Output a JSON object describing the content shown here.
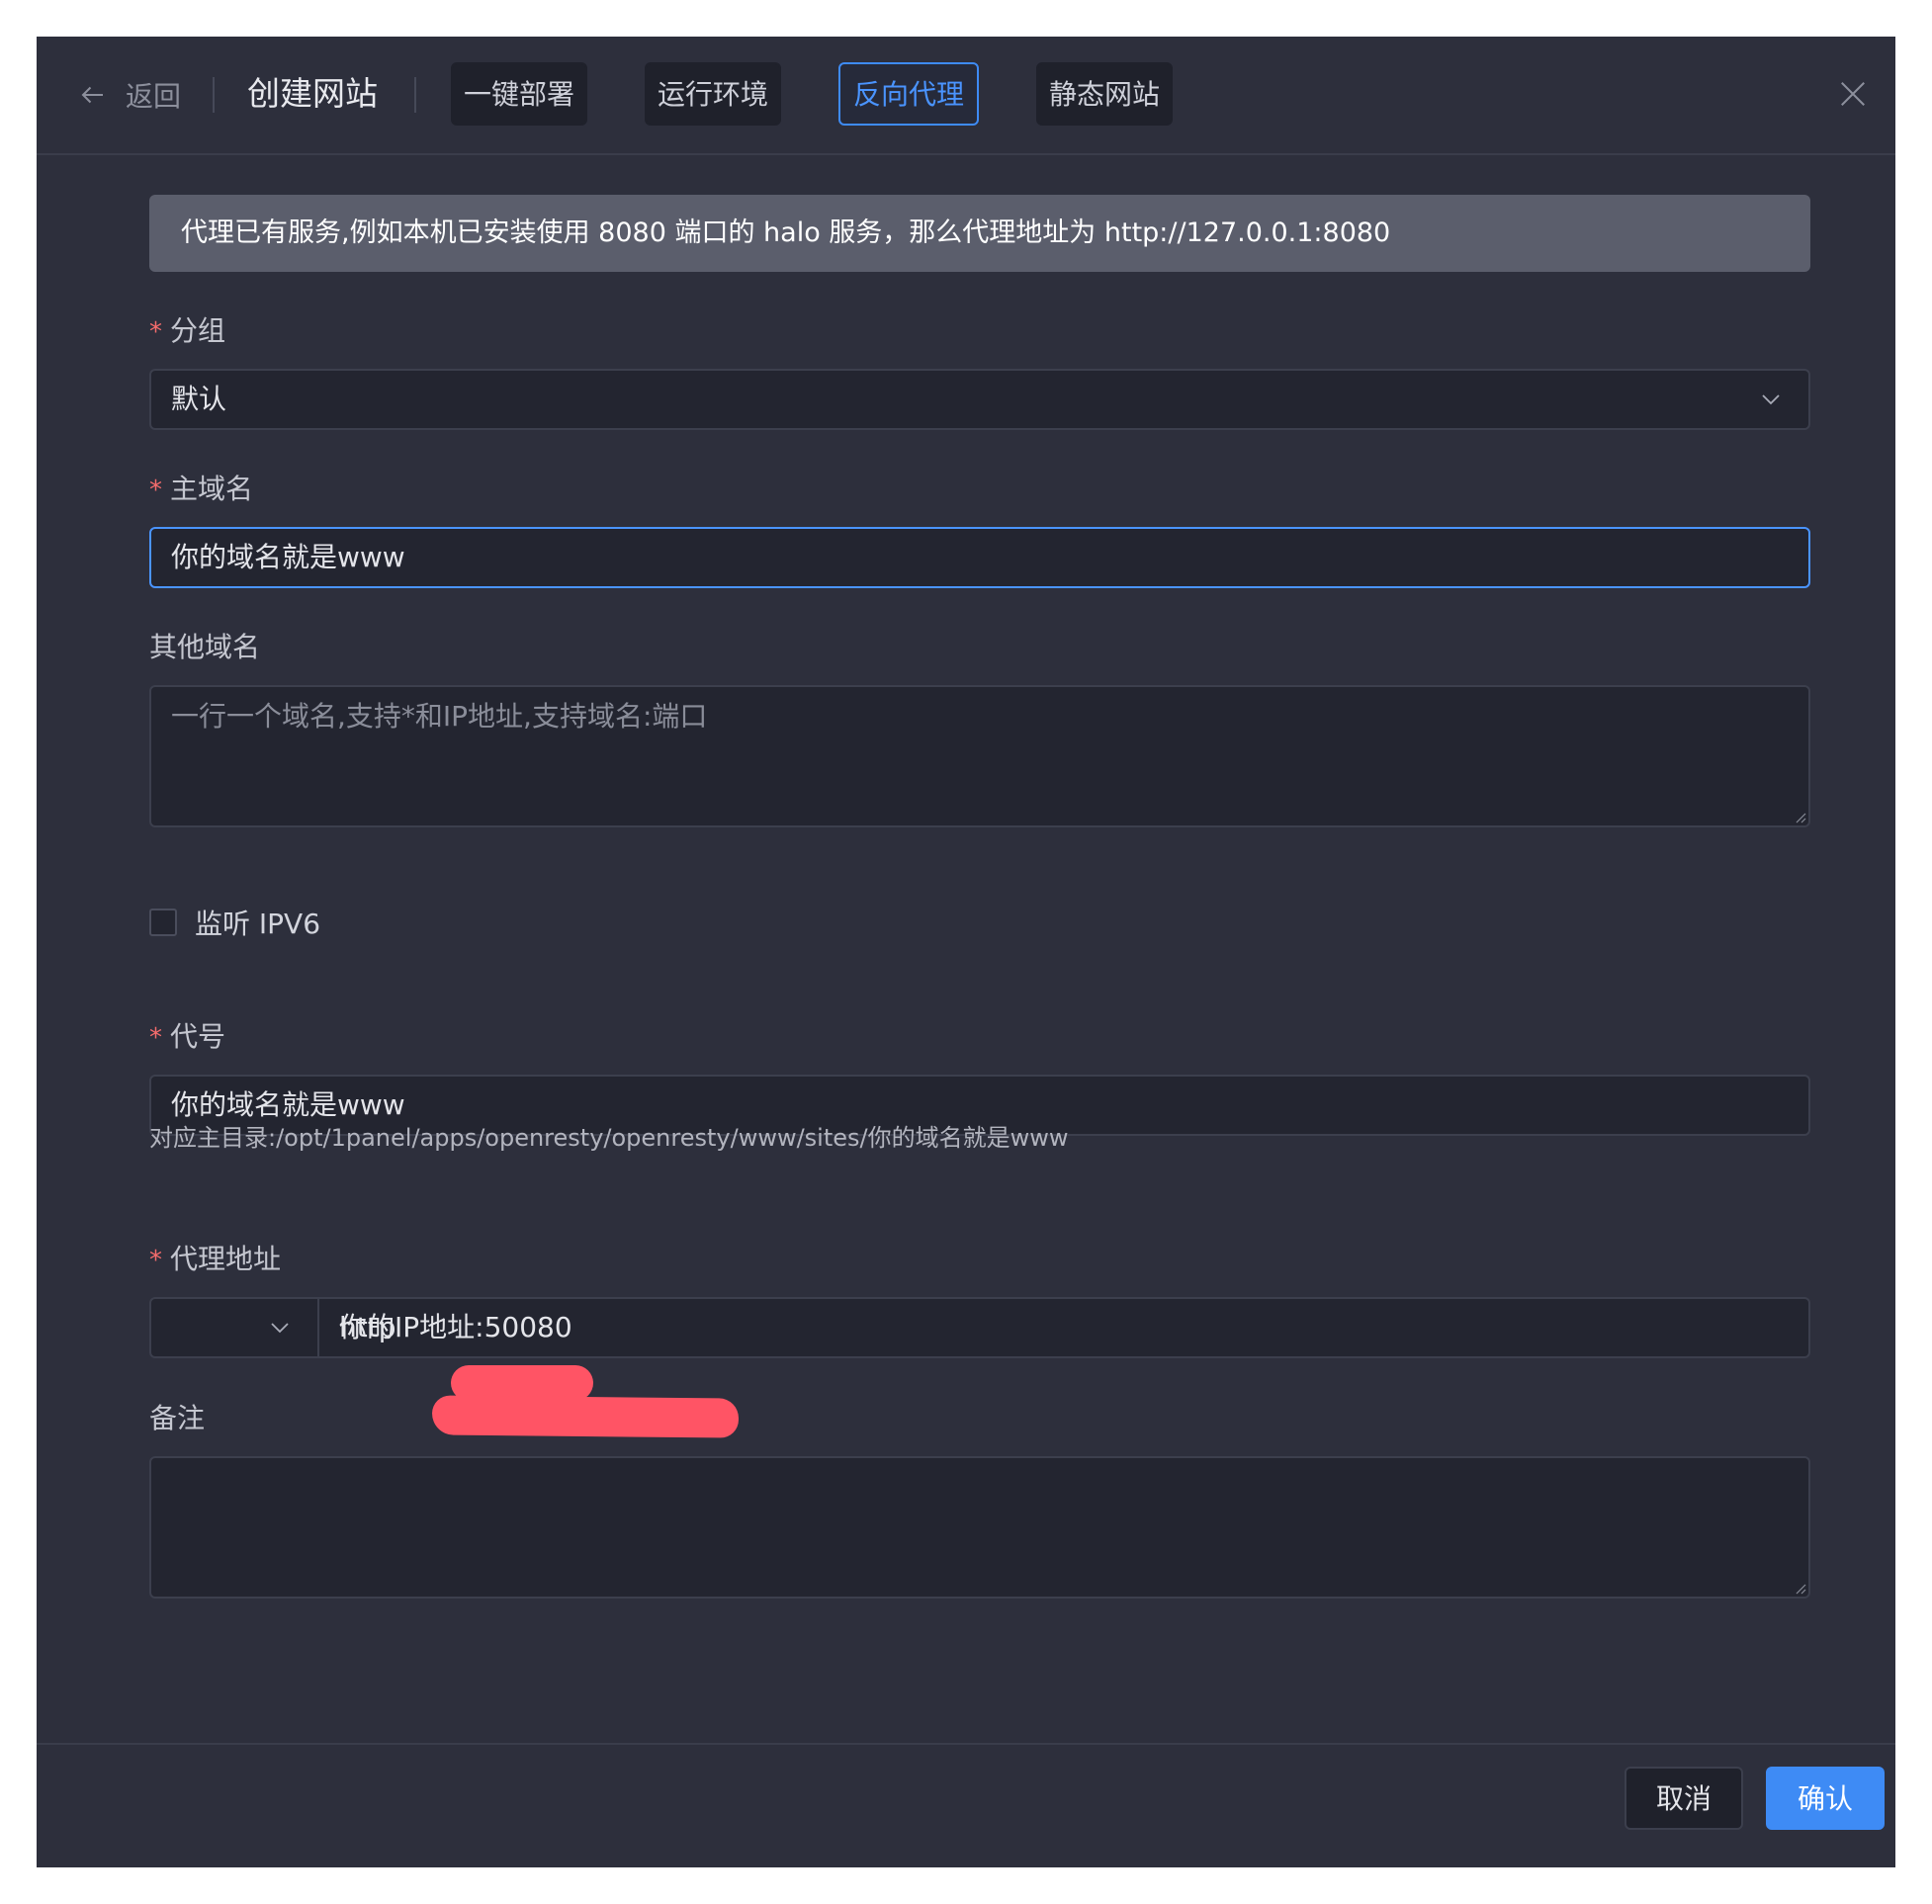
{
  "header": {
    "back_label": "返回",
    "title": "创建网站",
    "tabs": [
      {
        "label": "一键部署",
        "active": false
      },
      {
        "label": "运行环境",
        "active": false
      },
      {
        "label": "反向代理",
        "active": true
      },
      {
        "label": "静态网站",
        "active": false
      }
    ]
  },
  "alert": {
    "text": "代理已有服务,例如本机已安装使用 8080 端口的 halo 服务，那么代理地址为 http://127.0.0.1:8080"
  },
  "form": {
    "group": {
      "label": "分组",
      "required": true,
      "value": "默认"
    },
    "primary_domain": {
      "label": "主域名",
      "required": true,
      "value": "你的域名就是www"
    },
    "other_domains": {
      "label": "其他域名",
      "required": false,
      "value": "",
      "placeholder": "一行一个域名,支持*和IP地址,支持域名:端口"
    },
    "ipv6": {
      "label": "监听 IPV6",
      "checked": false
    },
    "alias": {
      "label": "代号",
      "required": true,
      "value": "你的域名就是www",
      "hint": "对应主目录:/opt/1panel/apps/openresty/openresty/www/sites/你的域名就是www"
    },
    "proxy": {
      "label": "代理地址",
      "required": true,
      "scheme": "http",
      "address": "你的IP地址:50080"
    },
    "remark": {
      "label": "备注",
      "required": false,
      "value": ""
    }
  },
  "footer": {
    "cancel_label": "取消",
    "confirm_label": "确认"
  },
  "colors": {
    "dialog_bg": "#2d2f3c",
    "accent": "#3e8bf5",
    "required": "#f56c6c",
    "redaction": "#ff5465"
  },
  "icons": {
    "back": "arrow-left-icon",
    "close": "close-icon",
    "select": "chevron-down-icon"
  }
}
